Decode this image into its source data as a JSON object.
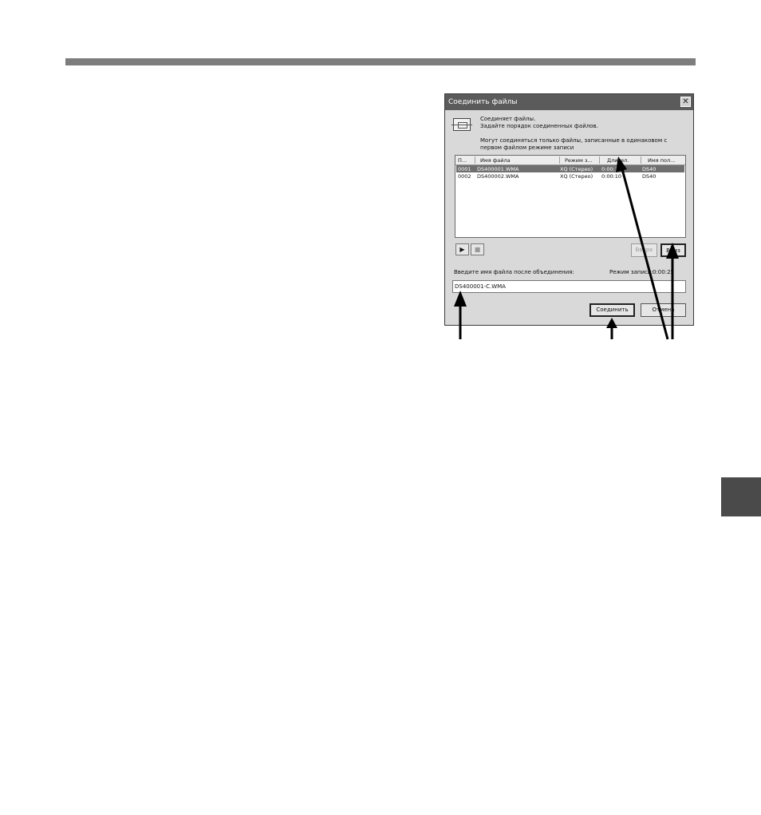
{
  "dialog": {
    "title": "Соединить файлы",
    "close_symbol": "✕",
    "icon": "merge-files-icon",
    "description_line1": "Соединяет файлы.",
    "description_line2": "Задайте порядок соединенных файлов.",
    "note_line1": "Могут соединяться только файлы, записанные в одинаковом с",
    "note_line2": "первом файлом режиме записи",
    "columns": [
      "П...",
      "Имя файла",
      "Режим з...",
      "Длител.",
      "Имя пол..."
    ],
    "rows": [
      {
        "index": "0001",
        "name": "DS400001.WMA",
        "mode": "XQ (Стерео)",
        "duration": "0:00:16",
        "folder": "DS40",
        "selected": true
      },
      {
        "index": "0002",
        "name": "DS400002.WMA",
        "mode": "XQ (Стерео)",
        "duration": "0:00:10",
        "folder": "DS40",
        "selected": false
      }
    ],
    "play_symbol": "▶",
    "stop_symbol": "■",
    "up_button": "Вверх",
    "down_button": "Вниз",
    "filename_label": "Введите имя файла после объединения:",
    "rec_mode_label": "Режим записи:",
    "rec_mode_value": "0:00:25",
    "filename_value": "DS400001-C.WMA",
    "join_button": "Соединить",
    "cancel_button": "Отмена"
  },
  "colors": {
    "titlebar": "#5b5b5b",
    "dialog_bg": "#d9d9d9",
    "selected_row": "#6e6e6e",
    "top_rule": "#7d7d7d",
    "side_tab": "#4a4a4a"
  }
}
